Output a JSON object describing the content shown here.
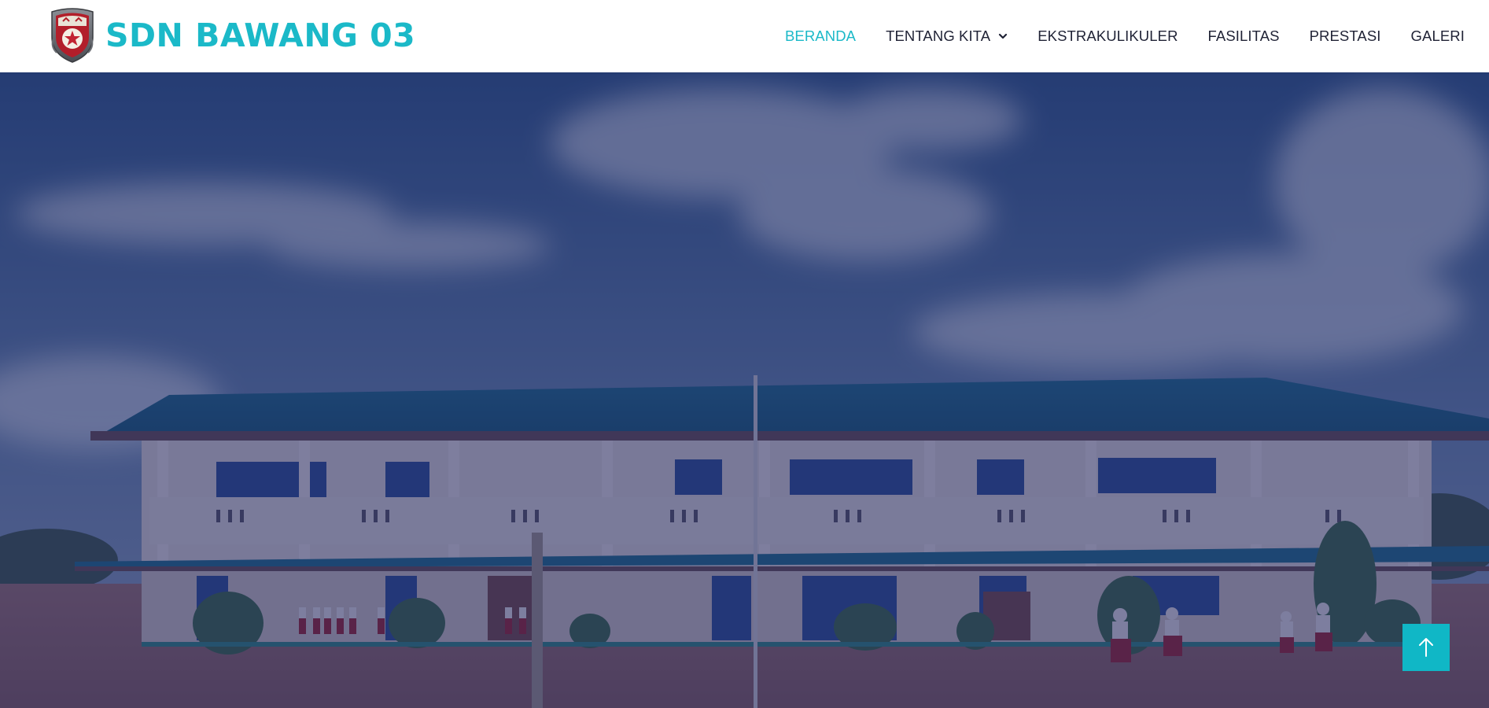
{
  "brand": {
    "name": "SDN BAWANG 03",
    "logo_icon": "school-crest-icon",
    "color": "#1bb9c8"
  },
  "nav": {
    "items": [
      {
        "label": "BERANDA",
        "active": true
      },
      {
        "label": "TENTANG KITA",
        "dropdown": true,
        "icon": "chevron-down-icon"
      },
      {
        "label": "EKSTRAKULIKULER"
      },
      {
        "label": "FASILITAS"
      },
      {
        "label": "PRESTASI"
      },
      {
        "label": "GALERI"
      }
    ],
    "active_color": "#1bb9c8",
    "text_color": "#1f2235"
  },
  "hero": {
    "image": "school-building-photo",
    "overlay_color": "#1d2560"
  },
  "back_to_top": {
    "icon": "arrow-up-icon",
    "color": "#10b7c6"
  }
}
